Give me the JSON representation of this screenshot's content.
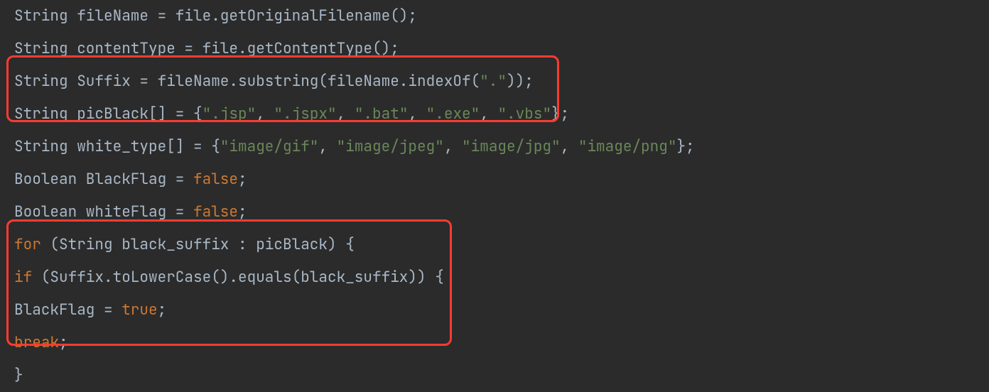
{
  "code": {
    "line1": {
      "t1": "String fileName = file.getOriginalFilename();"
    },
    "line2": {
      "t1": "String contentType = file.getContentType();"
    },
    "line3": {
      "p1": "String Suffix = fileName.substring(fileName.indexOf(",
      "s1": "\".\"",
      "p2": "));"
    },
    "line4": {
      "p1": "String picBlack[] = {",
      "s1": "\".jsp\"",
      "c1": ", ",
      "s2": "\".jspx\"",
      "c2": ", ",
      "s3": "\".bat\"",
      "c3": ", ",
      "s4": "\".exe\"",
      "c4": ", ",
      "s5": "\".vbs\"",
      "p2": "};"
    },
    "line5": {
      "p1": "String white_type[] = {",
      "s1": "\"image/gif\"",
      "c1": ", ",
      "s2": "\"image/jpeg\"",
      "c2": ", ",
      "s3": "\"image/jpg\"",
      "c3": ", ",
      "s4": "\"image/png\"",
      "p2": "};"
    },
    "line6": {
      "p1": "Boolean BlackFlag = ",
      "b1": "false",
      "p2": ";"
    },
    "line7": {
      "p1": "Boolean whiteFlag = ",
      "b1": "false",
      "p2": ";"
    },
    "line8": {
      "k1": "for",
      "p1": " (String black_suffix : picBlack) {"
    },
    "line9": {
      "k1": "if",
      "p1": " (Suffix.toLowerCase().equals(black_suffix)) {"
    },
    "line10": {
      "p1": "BlackFlag = ",
      "b1": "true",
      "p2": ";"
    },
    "line11": {
      "k1": "break",
      "p1": ";"
    },
    "line12": {
      "p1": "}"
    }
  },
  "highlights": {
    "box1_lines": "3-4",
    "box2_lines": "8-11"
  }
}
